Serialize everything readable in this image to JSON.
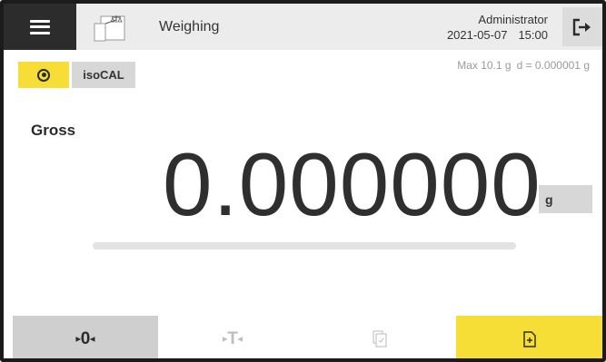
{
  "header": {
    "menu_icon": "hamburger-menu-icon",
    "app_icon": "scale-document-icon",
    "title": "Weighing",
    "user": "Administrator",
    "date": "2021-05-07",
    "time": "15:00",
    "logout_icon": "logout-arrow-icon"
  },
  "status": {
    "level_icon": "level-indicator-icon",
    "calibration_label": "isoCAL",
    "capacity_max": "Max 10.1 g",
    "readability": "d = 0.000001 g"
  },
  "reading": {
    "mode_label": "Gross",
    "value": "0.000000",
    "unit": "g",
    "capacity_used_fraction": 0
  },
  "bottom_bar": {
    "zero_label": "0",
    "tare_label": "T",
    "copy_icon": "copy-document-icon",
    "add_icon": "add-document-icon"
  },
  "colors": {
    "accent_yellow": "#F7DE37",
    "header_dark": "#2C2C2C",
    "header_bg": "#ECECEC",
    "button_gray": "#CFCFCF"
  }
}
